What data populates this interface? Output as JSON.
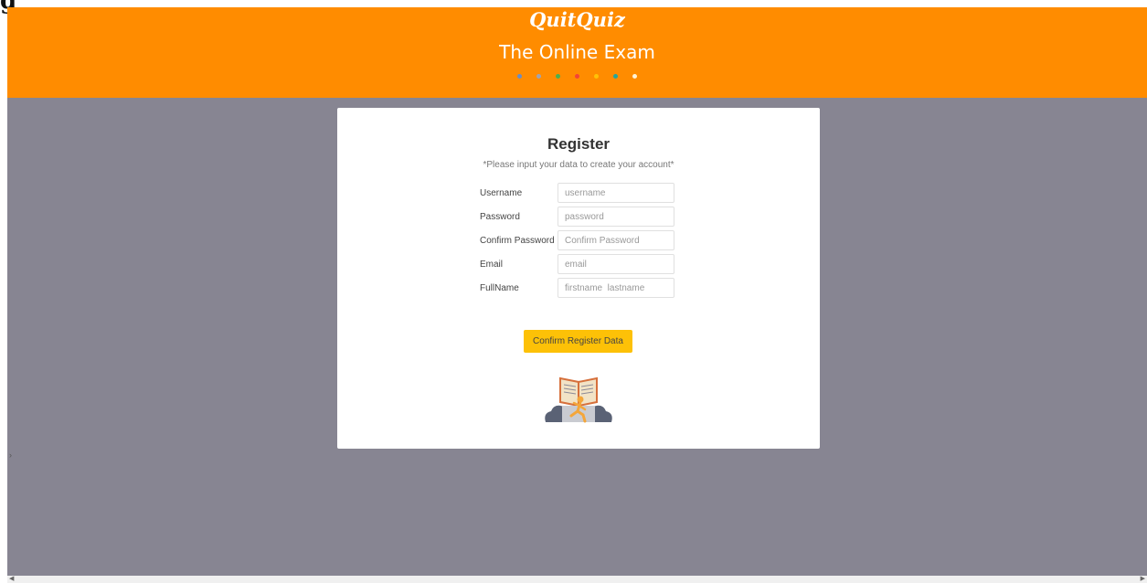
{
  "header": {
    "brand": "QuitQuiz",
    "subtitle": "The Online Exam",
    "dot_colors": [
      "#6b8dc4",
      "#a0a3b1",
      "#4caf50",
      "#f44336",
      "#ffc107",
      "#26a69a",
      "#fff3d6"
    ]
  },
  "card": {
    "title": "Register",
    "hint": "*Please input your data to create your account*",
    "fields": [
      {
        "label": "Username",
        "placeholder": "username",
        "value": ""
      },
      {
        "label": "Password",
        "placeholder": "password",
        "value": ""
      },
      {
        "label": "Confirm Password",
        "placeholder": "Confirm Password",
        "value": ""
      },
      {
        "label": "Email",
        "placeholder": "email",
        "value": ""
      },
      {
        "label": "FullName",
        "placeholder": "firstname  lastname",
        "value": ""
      }
    ],
    "submit_label": "Confirm Register Data"
  },
  "icons": {
    "illustration": "reading-student-book-icon",
    "side_chevron": "chevron-right-icon",
    "scroll_left": "scroll-left-arrow-icon",
    "scroll_right": "scroll-right-arrow-icon"
  },
  "colors": {
    "header_bg": "#ff8c00",
    "page_bg": "#878592",
    "button_bg": "#fdc107"
  }
}
